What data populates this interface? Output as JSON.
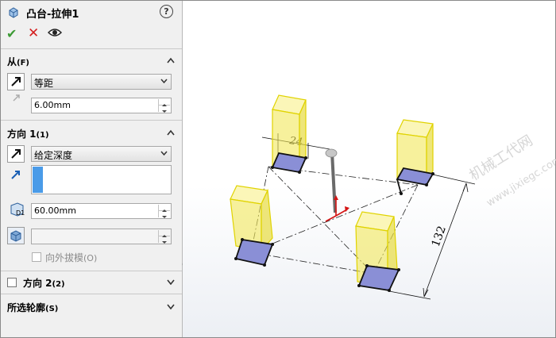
{
  "panel": {
    "title": "凸台-拉伸1",
    "help": "?",
    "from_group": {
      "label": "从",
      "shortcut": "(F)",
      "condition": "等距",
      "offset_value": "6.00mm"
    },
    "direction1": {
      "label": "方向 1",
      "shortcut": "(1)",
      "end_condition": "给定深度",
      "depth_value": "60.00mm",
      "draft_value": "",
      "draft_outward_label": "向外拔模",
      "draft_outward_shortcut": "(O)"
    },
    "direction2": {
      "label": "方向 2",
      "shortcut": "(2)"
    },
    "selected_contours": {
      "label": "所选轮廓",
      "shortcut": "(S)"
    }
  },
  "viewport": {
    "dim_top": "24",
    "dim_side": "132",
    "watermark_cn": "机械工代网",
    "watermark_url": "www.jixiegc.com"
  },
  "colors": {
    "accent_green": "#3c9a34",
    "cancel_red": "#d42020",
    "preview_yellow": "#f2e85a",
    "selection_blue": "#4a9be8"
  }
}
